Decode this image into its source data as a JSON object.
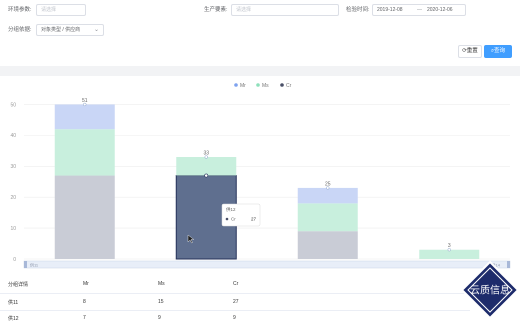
{
  "filters": {
    "env_label": "环境参数:",
    "env_placeholder": "请选择",
    "production_label": "生产要素:",
    "production_placeholder": "请选择",
    "inspect_time_label": "检验时间:",
    "date_start": "2019-12-08",
    "date_sep": "—",
    "date_end": "2020-12-06",
    "group_label": "分组依据:",
    "group_value": "对象类型 / 供应商"
  },
  "actions": {
    "reset_label": "重置",
    "query_label": "查询"
  },
  "chart_data": {
    "type": "bar",
    "stacked": true,
    "categories": [
      "供11",
      "供12",
      "供13",
      "供14"
    ],
    "series": [
      {
        "name": "Mr",
        "color": "#c9d6f6",
        "values": [
          8,
          0,
          5,
          0
        ]
      },
      {
        "name": "Ms",
        "color": "#c8efdd",
        "values": [
          15,
          6,
          9,
          3
        ]
      },
      {
        "name": "Cr",
        "color": "#c9ccd6",
        "values": [
          27,
          27,
          9,
          0
        ]
      }
    ],
    "totals": [
      "51",
      "33",
      "25",
      "3"
    ],
    "y_ticks": [
      "50",
      "40",
      "30",
      "20",
      "10",
      "0"
    ],
    "ylim": [
      0,
      55
    ],
    "legend_position": "top-center",
    "grid": true,
    "highlight": {
      "category_index": 1,
      "color": "#5f6f8f"
    },
    "tooltip": {
      "title": "供12",
      "series_name": "Cr",
      "value": "27"
    },
    "slider_start_label": "供11",
    "slider_end_label": "供14"
  },
  "details": {
    "headers": [
      "分组详情",
      "Mr",
      "Ms",
      "Cr"
    ],
    "rows": [
      [
        "供11",
        "8",
        "15",
        "27"
      ],
      [
        "供12",
        "7",
        "9",
        "9"
      ]
    ]
  },
  "watermark": {
    "text": "云质信息"
  }
}
